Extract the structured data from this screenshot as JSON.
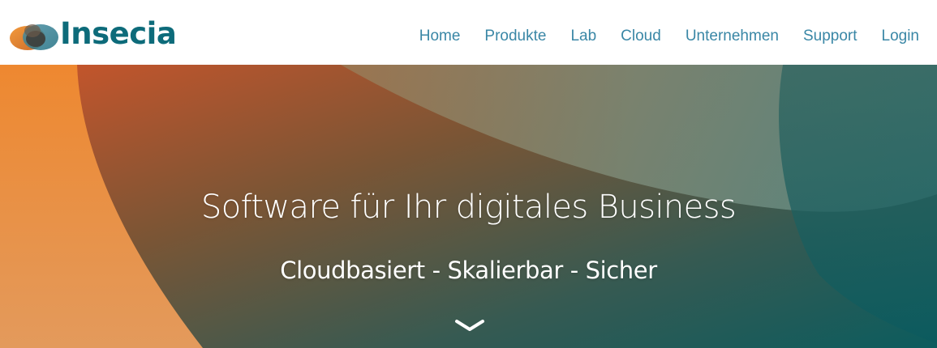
{
  "brand": {
    "name": "Insecia",
    "color": "#0d6b7a"
  },
  "nav": {
    "items": [
      "Home",
      "Produkte",
      "Lab",
      "Cloud",
      "Unternehmen",
      "Support",
      "Login"
    ],
    "color": "#3a87a6"
  },
  "hero": {
    "title": "Software für Ihr digitales Business",
    "subtitle": "Cloudbasiert - Skalierbar - Sicher",
    "scroll_icon": "chevron-down-icon",
    "colors": {
      "orange": "#f08a2e",
      "brown": "#7a5233",
      "teal": "#0c5c5e"
    }
  }
}
